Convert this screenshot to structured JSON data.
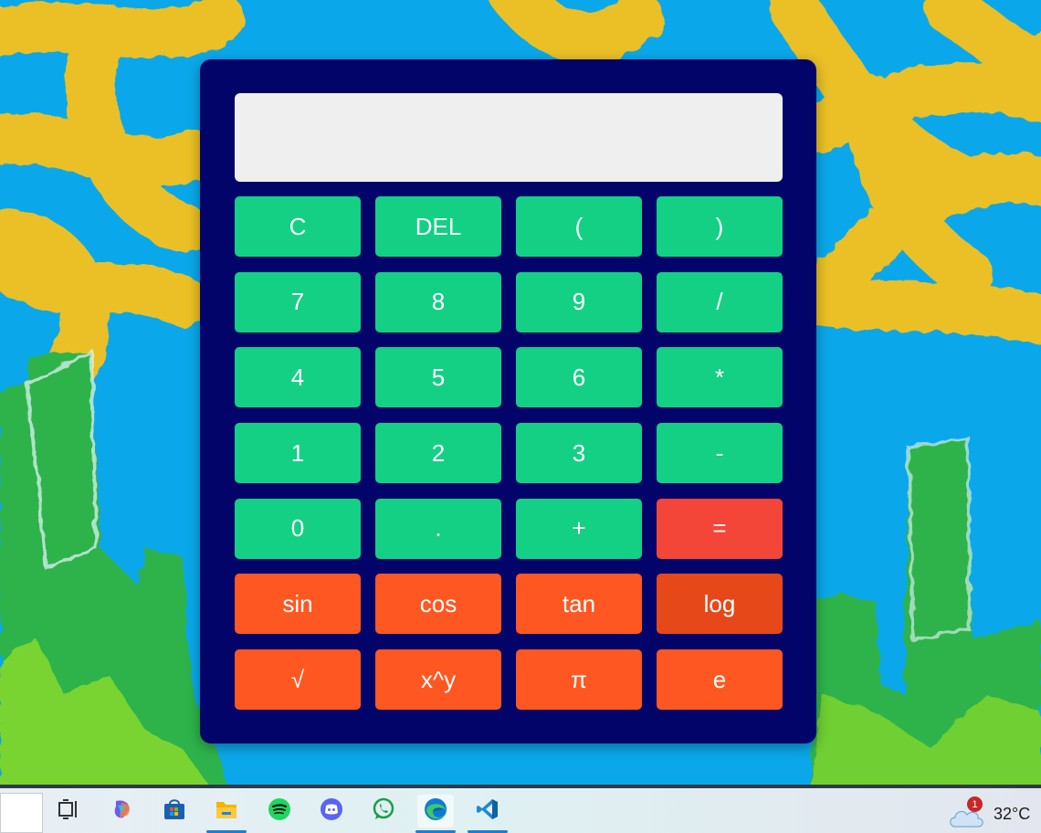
{
  "calculator": {
    "display_value": "",
    "keys": [
      {
        "label": "C",
        "type": "num",
        "name": "clear-button"
      },
      {
        "label": "DEL",
        "type": "num",
        "name": "delete-button"
      },
      {
        "label": "(",
        "type": "num",
        "name": "open-paren-button"
      },
      {
        "label": ")",
        "type": "num",
        "name": "close-paren-button"
      },
      {
        "label": "7",
        "type": "num",
        "name": "digit-7-button"
      },
      {
        "label": "8",
        "type": "num",
        "name": "digit-8-button"
      },
      {
        "label": "9",
        "type": "num",
        "name": "digit-9-button"
      },
      {
        "label": "/",
        "type": "num",
        "name": "divide-button"
      },
      {
        "label": "4",
        "type": "num",
        "name": "digit-4-button"
      },
      {
        "label": "5",
        "type": "num",
        "name": "digit-5-button"
      },
      {
        "label": "6",
        "type": "num",
        "name": "digit-6-button"
      },
      {
        "label": "*",
        "type": "num",
        "name": "multiply-button"
      },
      {
        "label": "1",
        "type": "num",
        "name": "digit-1-button"
      },
      {
        "label": "2",
        "type": "num",
        "name": "digit-2-button"
      },
      {
        "label": "3",
        "type": "num",
        "name": "digit-3-button"
      },
      {
        "label": "-",
        "type": "num",
        "name": "subtract-button"
      },
      {
        "label": "0",
        "type": "num",
        "name": "digit-0-button"
      },
      {
        "label": ".",
        "type": "num",
        "name": "decimal-button"
      },
      {
        "label": "+",
        "type": "num",
        "name": "add-button"
      },
      {
        "label": "=",
        "type": "equals",
        "name": "equals-button"
      },
      {
        "label": "sin",
        "type": "fn",
        "name": "sin-button"
      },
      {
        "label": "cos",
        "type": "fn",
        "name": "cos-button"
      },
      {
        "label": "tan",
        "type": "fn",
        "name": "tan-button"
      },
      {
        "label": "log",
        "type": "fn active",
        "name": "log-button"
      },
      {
        "label": "√",
        "type": "fn",
        "name": "sqrt-button"
      },
      {
        "label": "x^y",
        "type": "fn",
        "name": "power-button"
      },
      {
        "label": "π",
        "type": "fn",
        "name": "pi-button"
      },
      {
        "label": "e",
        "type": "fn",
        "name": "euler-button"
      }
    ]
  },
  "colors": {
    "panel": "#02046a",
    "display": "#efefef",
    "number_key": "#13d084",
    "equals_key": "#f34638",
    "function_key": "#ff5722",
    "function_key_hover": "#e6481a"
  },
  "taskbar": {
    "icons": [
      {
        "name": "task-view-icon",
        "active": false
      },
      {
        "name": "copilot-icon",
        "active": false
      },
      {
        "name": "microsoft-store-icon",
        "active": false
      },
      {
        "name": "file-explorer-icon",
        "active": false,
        "running": true
      },
      {
        "name": "spotify-icon",
        "active": false
      },
      {
        "name": "discord-icon",
        "active": false
      },
      {
        "name": "whatsapp-icon",
        "active": false
      },
      {
        "name": "edge-icon",
        "active": true,
        "running": true
      },
      {
        "name": "vscode-icon",
        "active": false,
        "running": true
      }
    ],
    "weather": {
      "icon": "cloud-icon",
      "badge": "1",
      "temperature": "32°C"
    }
  }
}
